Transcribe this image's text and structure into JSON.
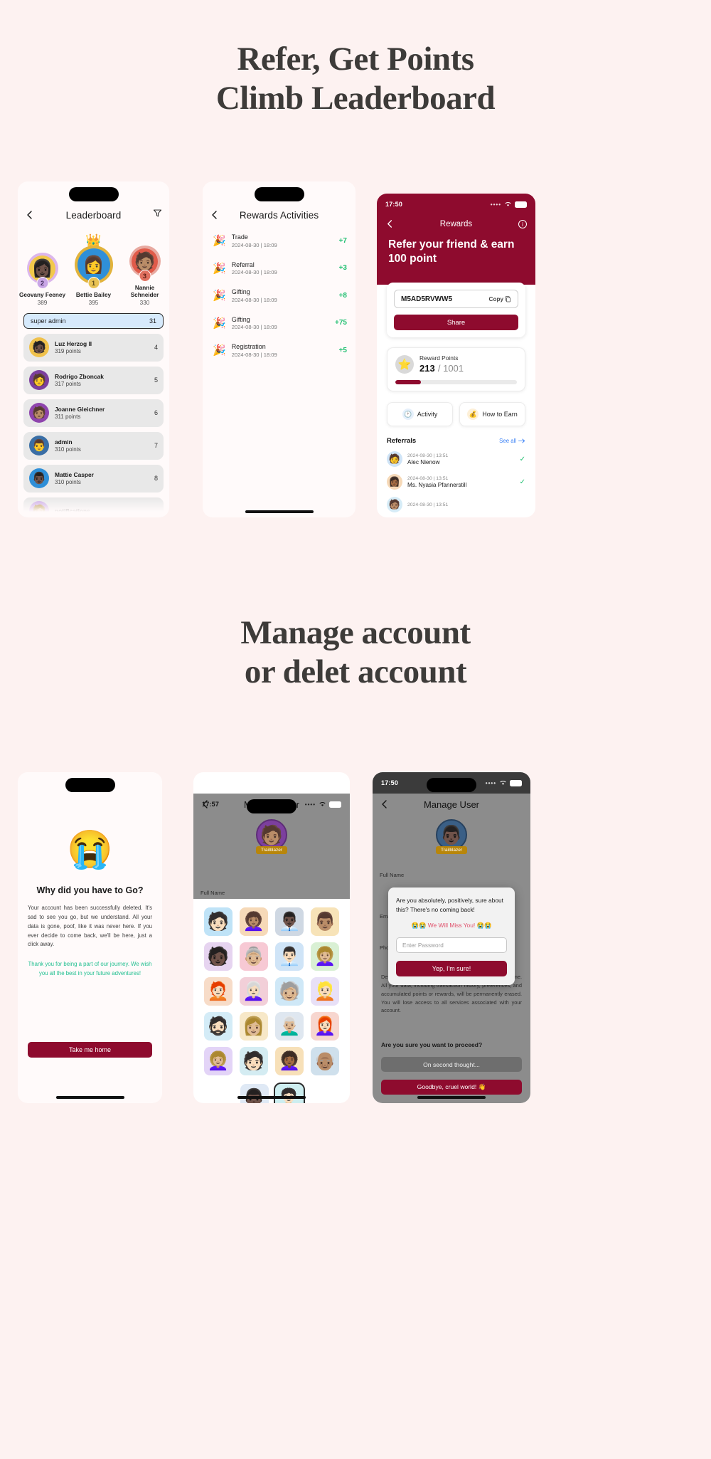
{
  "headlines": {
    "top_line1": "Refer, Get Points",
    "top_line2": "Climb Leaderboard",
    "bottom_line1": "Manage account",
    "bottom_line2": "or delet account"
  },
  "colors": {
    "page_bg": "#fdf2f1",
    "brand_maroon": "#8e0b2e",
    "green_points": "#1fbf70",
    "headline": "#3d3b39"
  },
  "leaderboard": {
    "title": "Leaderboard",
    "back_icon": "chevron-left-icon",
    "filter_icon": "filter-icon",
    "podium": [
      {
        "rank": "2",
        "name": "Geovany Feeney",
        "score": "389",
        "emoji": "👩🏿"
      },
      {
        "rank": "1",
        "name": "Bettie Bailey",
        "score": "395",
        "emoji": "👩",
        "crown": "👑"
      },
      {
        "rank": "3",
        "name": "Nannie Schneider",
        "score": "330",
        "emoji": "🧑🏽"
      }
    ],
    "self_row": {
      "label": "super admin",
      "rank": "31"
    },
    "rows": [
      {
        "name": "Luz Herzog II",
        "points": "319 points",
        "rank": "4",
        "emoji": "🧑🏿"
      },
      {
        "name": "Rodrigo Zboncak",
        "points": "317 points",
        "rank": "5",
        "emoji": "🧑"
      },
      {
        "name": "Joanne Gleichner",
        "points": "311 points",
        "rank": "6",
        "emoji": "🧑🏽"
      },
      {
        "name": "admin",
        "points": "310 points",
        "rank": "7",
        "emoji": "👨"
      },
      {
        "name": "Mattie Casper",
        "points": "310 points",
        "rank": "8",
        "emoji": "👨🏿"
      },
      {
        "name": "notifications",
        "points": "",
        "rank": "",
        "emoji": "🧑🏼"
      }
    ]
  },
  "activities": {
    "title": "Rewards Activities",
    "back_icon": "chevron-left-icon",
    "rows": [
      {
        "icon": "🎉",
        "title": "Trade",
        "date": "2024-08-30 | 18:09",
        "points": "+7"
      },
      {
        "icon": "🎉",
        "title": "Referral",
        "date": "2024-08-30 | 18:09",
        "points": "+3"
      },
      {
        "icon": "🎉",
        "title": "Gifting",
        "date": "2024-08-30 | 18:09",
        "points": "+8"
      },
      {
        "icon": "🎉",
        "title": "Gifting",
        "date": "2024-08-30 | 18:09",
        "points": "+75"
      },
      {
        "icon": "🎉",
        "title": "Registration",
        "date": "2024-08-30 | 18:09",
        "points": "+5"
      }
    ]
  },
  "rewards": {
    "status_time": "17:50",
    "title": "Rewards",
    "back_icon": "chevron-left-icon",
    "info_icon": "info-icon",
    "tagline": "Refer your friend & earn 100 point",
    "referral_code": "M5AD5RVWW5",
    "copy_label": "Copy",
    "copy_icon": "copy-icon",
    "share_label": "Share",
    "points_label": "Reward Points",
    "points_value": "213",
    "points_total": "/ 1001",
    "progress_percent": 21,
    "star_icon": "star-icon",
    "buttons": [
      {
        "label": "Activity",
        "icon": "clock-icon"
      },
      {
        "label": "How to Earn",
        "icon": "coin-icon"
      }
    ],
    "referrals_title": "Referrals",
    "see_all": "See all",
    "arrow_icon": "arrow-right-icon",
    "referrals": [
      {
        "date": "2024-08-30 | 13:51",
        "name": "Alec Nienow",
        "emoji": "🧑",
        "check": "✓"
      },
      {
        "date": "2024-08-30 | 13:51",
        "name": "Ms. Nyasia Pfannerstill",
        "emoji": "👩🏾",
        "check": "✓"
      },
      {
        "date": "2024-08-30 | 13:51",
        "name": "",
        "emoji": "🧑🏽",
        "check": ""
      }
    ]
  },
  "account_deleted": {
    "emoji": "😭",
    "title": "Why did you have to Go?",
    "body": "Your account has been successfully deleted. It's sad to see you go, but we understand. All your data is gone, poof, like it was never here. If you ever decide to come back, we'll be here, just a click away.",
    "thanks": "Thank you for being a part of our journey. We wish you all the best in your future adventures!",
    "button": "Take me home"
  },
  "manage_user_avatars": {
    "status_time": "17:57",
    "title": "Manage User",
    "back_icon": "chevron-left-icon",
    "badge": "Trailblazer",
    "field_label": "Full Name",
    "selected_index": 21,
    "avatars": [
      "🧑🏻",
      "👩🏽‍🦱",
      "👨🏿‍💼",
      "👨🏽",
      "🧑🏿",
      "👵🏼",
      "👨🏻‍💼",
      "👩🏼‍🦱",
      "🧑🏻‍🦰",
      "👩🏻‍🦳",
      "🧓🏼",
      "👱🏻",
      "🧔🏻",
      "👩🏼",
      "👨🏼‍🦳",
      "👩🏻‍🦰",
      "👩🏼‍🦱",
      "🧑🏻",
      "👩🏾‍🦱",
      "👴🏽",
      "👨🏿",
      "🧑🏻‍🦱"
    ]
  },
  "delete_confirm": {
    "status_time": "17:50",
    "title": "Manage User",
    "back_icon": "chevron-left-icon",
    "badge": "Trailblazer",
    "field_label": "Full Name",
    "field_label2": "Email",
    "field_label3": "Phone",
    "warning_text": "Deleting your account is permanent and cannot be undone. All your data, including transaction history, preferences, and accumulated points or rewards, will be permanently erased. You will lose access to all services associated with your account.",
    "question": "Are you sure you want to proceed?",
    "cancel_button": "On second thought...",
    "confirm_button": "Goodbye, cruel world! 👋",
    "dialog": {
      "text": "Are you absolutely, positively, sure about this? There's no coming back!",
      "miss_you": "😭😭 We Will Miss You! 😭😭",
      "input_placeholder": "Enter Password",
      "button": "Yep, I'm sure!"
    }
  }
}
